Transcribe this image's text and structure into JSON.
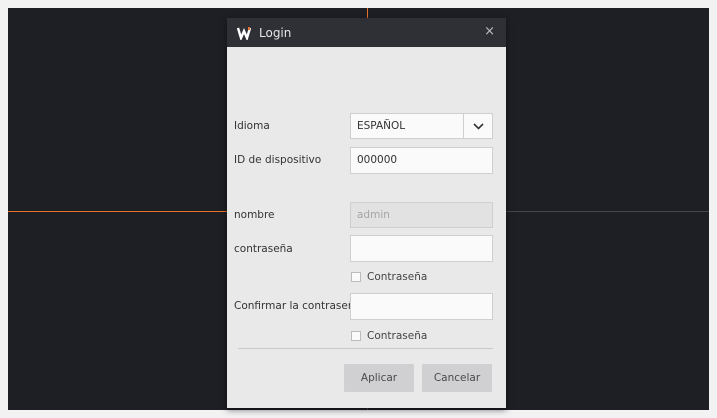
{
  "dialog": {
    "title": "Login",
    "logo_icon": "brand-w-icon",
    "close_icon": "close-icon",
    "close_glyph": "×"
  },
  "form": {
    "language_label": "Idioma",
    "language_value": "ESPAÑOL",
    "device_id_label": "ID de dispositivo",
    "device_id_value": "000000",
    "name_label": "nombre",
    "name_value": "admin",
    "password_label": "contraseña",
    "password_value": "",
    "show_password_label": "Contraseña",
    "confirm_label": "Confirmar la contraseña",
    "confirm_value": "",
    "show_confirm_label": "Contraseña"
  },
  "buttons": {
    "apply": "Aplicar",
    "cancel": "Cancelar"
  },
  "colors": {
    "background": "#1e1f25",
    "active_grid": "#e8722c",
    "titlebar": "#2f3036",
    "dialog": "#e9e9ea"
  }
}
